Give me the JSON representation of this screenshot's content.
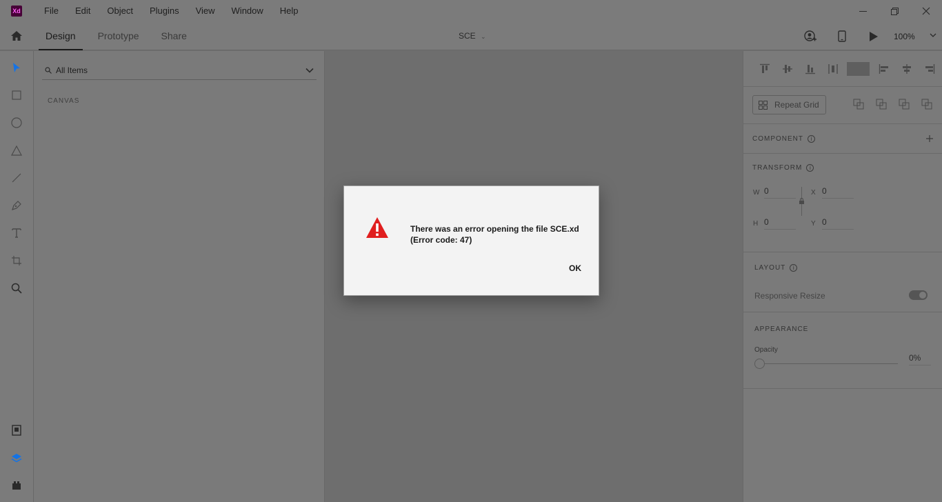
{
  "app": {
    "logo_text": "Xd",
    "menu": [
      "File",
      "Edit",
      "Object",
      "Plugins",
      "View",
      "Window",
      "Help"
    ]
  },
  "window_controls": {
    "minimize": "—",
    "restore": "❐",
    "close": "✕"
  },
  "toolbar": {
    "tabs": [
      "Design",
      "Prototype",
      "Share"
    ],
    "active_tab": "Design",
    "document_title": "SCE",
    "zoom": "100%"
  },
  "layers": {
    "search_placeholder": "All Items",
    "section_label": "CANVAS"
  },
  "inspector": {
    "repeat_grid_label": "Repeat Grid",
    "component_label": "COMPONENT",
    "transform_label": "TRANSFORM",
    "w_label": "W",
    "w_value": "0",
    "x_label": "X",
    "x_value": "0",
    "h_label": "H",
    "h_value": "0",
    "y_label": "Y",
    "y_value": "0",
    "layout_label": "LAYOUT",
    "responsive_resize_label": "Responsive Resize",
    "appearance_label": "APPEARANCE",
    "opacity_label": "Opacity",
    "opacity_value": "0%"
  },
  "dialog": {
    "message_line1": "There was an error opening the file SCE.xd",
    "message_line2": "(Error code: 47)",
    "ok_label": "OK",
    "icon_color": "#e01e1e"
  },
  "colors": {
    "accent": "#1473e6",
    "chrome": "#7b7b7b",
    "canvas": "#6e6e6e",
    "dialog_bg": "#f3f3f3"
  }
}
